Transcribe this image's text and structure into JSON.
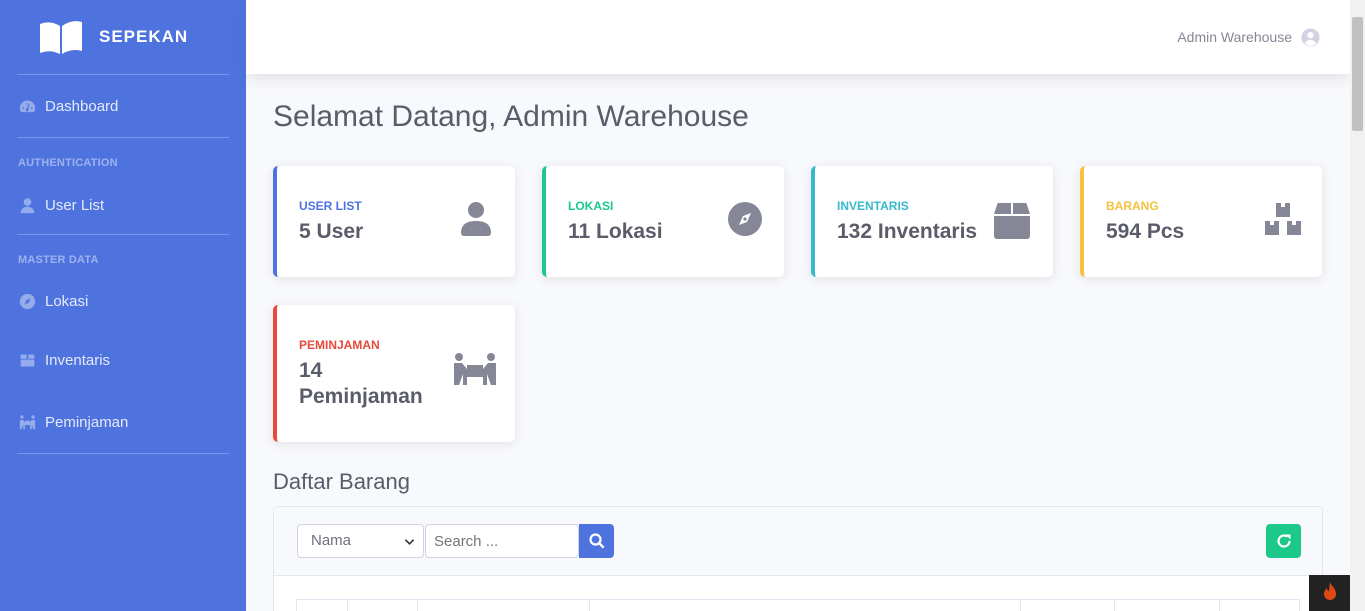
{
  "brand": {
    "name": "SEPEKAN",
    "logo_icon": "open-book-icon"
  },
  "sidebar": {
    "dashboard": {
      "label": "Dashboard",
      "icon": "tachometer-icon"
    },
    "heading_auth": "AUTHENTICATION",
    "user_list": {
      "label": "User List",
      "icon": "user-icon"
    },
    "heading_master": "MASTER DATA",
    "lokasi": {
      "label": "Lokasi",
      "icon": "compass-icon"
    },
    "inventaris": {
      "label": "Inventaris",
      "icon": "box-icon"
    },
    "peminjaman": {
      "label": "Peminjaman",
      "icon": "people-carry-icon"
    }
  },
  "topbar": {
    "user_name": "Admin Warehouse",
    "avatar_icon": "user-circle-icon"
  },
  "page": {
    "title": "Selamat Datang, Admin Warehouse"
  },
  "cards": [
    {
      "label": "USER LIST",
      "value": "5 User",
      "color": "#4e73df",
      "icon": "user-icon"
    },
    {
      "label": "LOKASI",
      "value": "11 Lokasi",
      "color": "#1cc88a",
      "icon": "compass-icon"
    },
    {
      "label": "INVENTARIS",
      "value": "132 Inventaris",
      "color": "#36b9cc",
      "icon": "box-icon"
    },
    {
      "label": "BARANG",
      "value": "594 Pcs",
      "color": "#f6c23e",
      "icon": "boxes-icon"
    },
    {
      "label": "PEMINJAMAN",
      "value": "14 Peminjaman",
      "color": "#e74a3b",
      "icon": "people-carry-icon"
    }
  ],
  "daftar": {
    "title": "Daftar Barang",
    "filter_selected": "Nama",
    "search_placeholder": "Search ...",
    "search_icon": "search-icon",
    "refresh_icon": "refresh-icon"
  },
  "colors": {
    "primary": "#4e73df",
    "success": "#1cc88a",
    "info": "#36b9cc",
    "warning": "#f6c23e",
    "danger": "#e74a3b"
  }
}
